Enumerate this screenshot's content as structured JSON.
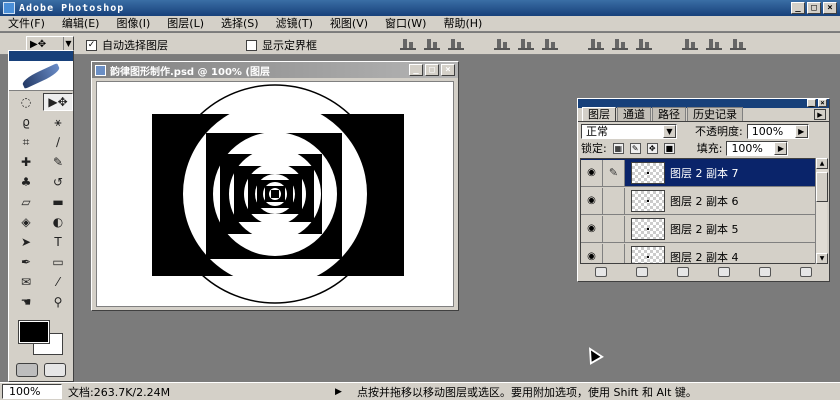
{
  "app": {
    "title": "Adobe Photoshop",
    "window_buttons": {
      "minimize": "_",
      "maximize": "□",
      "close": "×"
    }
  },
  "menu": {
    "items": [
      "文件(F)",
      "编辑(E)",
      "图像(I)",
      "图层(L)",
      "选择(S)",
      "滤镜(T)",
      "视图(V)",
      "窗口(W)",
      "帮助(H)"
    ]
  },
  "options_bar": {
    "tool_preset_icon": "move-tool-icon",
    "auto_select_label": "自动选择图层",
    "auto_select_checked": true,
    "auto_select_mark": "✓",
    "show_bounding_label": "显示定界框",
    "show_bounding_checked": false
  },
  "toolbox": {
    "tools": [
      "marquee-icon",
      "move-icon",
      "lasso-icon",
      "magic-wand-icon",
      "crop-icon",
      "slice-icon",
      "healing-brush-icon",
      "brush-icon",
      "clone-stamp-icon",
      "history-brush-icon",
      "eraser-icon",
      "gradient-icon",
      "blur-icon",
      "dodge-icon",
      "path-selection-icon",
      "type-icon",
      "pen-icon",
      "rectangle-shape-icon",
      "notes-icon",
      "eyedropper-icon",
      "hand-icon",
      "zoom-icon"
    ],
    "foreground_color": "#000000",
    "background_color": "#ffffff"
  },
  "document": {
    "title": "韵律图形制作.psd @ 100% (图层",
    "canvas_color": "#ffffff"
  },
  "layers_panel": {
    "tabs": [
      "图层",
      "通道",
      "路径",
      "历史记录"
    ],
    "active_tab": "图层",
    "blend_mode": "正常",
    "opacity_label": "不透明度:",
    "opacity_value": "100%",
    "lock_label": "锁定:",
    "fill_label": "填充:",
    "fill_value": "100%",
    "layers": [
      {
        "name": "图层 2 副本 7",
        "visible": true,
        "active": true
      },
      {
        "name": "图层 2 副本 6",
        "visible": true,
        "active": false
      },
      {
        "name": "图层 2 副本 5",
        "visible": true,
        "active": false
      },
      {
        "name": "图层 2 副本 4",
        "visible": true,
        "active": false
      }
    ]
  },
  "status": {
    "zoom": "100%",
    "doc_info": "文档:263.7K/2.24M",
    "hint": "点按并拖移以移动图层或选区。要用附加选项，使用 Shift 和 Alt 键。"
  }
}
